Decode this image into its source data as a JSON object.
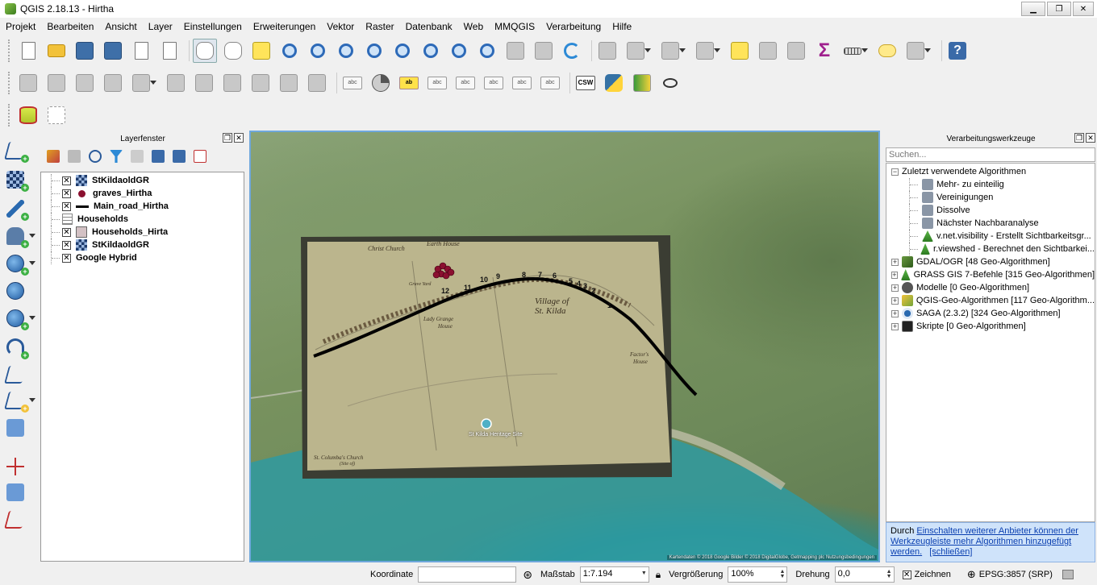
{
  "window": {
    "title": "QGIS 2.18.13 - Hirtha"
  },
  "menu": [
    "Projekt",
    "Bearbeiten",
    "Ansicht",
    "Layer",
    "Einstellungen",
    "Erweiterungen",
    "Vektor",
    "Raster",
    "Datenbank",
    "Web",
    "MMQGIS",
    "Verarbeitung",
    "Hilfe"
  ],
  "layers_panel": {
    "title": "Layerfenster",
    "layers": [
      {
        "name": "StKildaoldGR",
        "checked": true,
        "symbol": "raster",
        "indent": true
      },
      {
        "name": "graves_Hirtha",
        "checked": true,
        "symbol": "point",
        "color": "#8b1030",
        "indent": true
      },
      {
        "name": "Main_road_Hirtha",
        "checked": true,
        "symbol": "line",
        "color": "#000000",
        "indent": true
      },
      {
        "name": "Households",
        "checked": false,
        "symbol": "table",
        "indent": true
      },
      {
        "name": "Households_Hirta",
        "checked": true,
        "symbol": "polygon",
        "color": "#d3c1c4",
        "indent": true
      },
      {
        "name": "StKildaoldGR",
        "checked": true,
        "symbol": "raster",
        "indent": true
      },
      {
        "name": "Google Hybrid",
        "checked": true,
        "symbol": "none",
        "indent": true
      }
    ]
  },
  "map": {
    "labels": {
      "christ_church": "Christ Church",
      "earth_house": "Earth House",
      "village": "Village of",
      "st_kilda": "St. Kilda",
      "lady_grange": "Lady Grange",
      "lady_grange_2": "House",
      "st_columba": "St. Columba's Church",
      "site_of": "(Site of)",
      "factor_house": "Factor's",
      "factor_house_2": "House",
      "grave_yard": "Grave Yard",
      "marker": "St Kilda Heritage Site"
    },
    "house_numbers": [
      "12",
      "11",
      "10",
      "9",
      "8",
      "7",
      "6",
      "5",
      "4",
      "3",
      "2",
      "1"
    ],
    "attribution": "Kartendaten © 2018 Google Bilder © 2018 DigitalGlobe, Getmapping plc  Nutzungsbedingungen"
  },
  "processing_panel": {
    "title": "Verarbeitungswerkzeuge",
    "search_placeholder": "Suchen...",
    "recent_group": "Zuletzt verwendete Algorithmen",
    "recent": [
      "Mehr- zu einteilig",
      "Vereinigungen",
      "Dissolve",
      "Nächster Nachbaranalyse",
      "v.net.visibility - Erstellt Sichtbarkeitsgr...",
      "r.viewshed - Berechnet den Sichtbarkei..."
    ],
    "providers": [
      {
        "label": "GDAL/OGR [48 Geo-Algorithmen]",
        "icon": "gdal"
      },
      {
        "label": "GRASS GIS 7-Befehle [315 Geo-Algorithmen]",
        "icon": "grass"
      },
      {
        "label": "Modelle [0 Geo-Algorithmen]",
        "icon": "model"
      },
      {
        "label": "QGIS-Geo-Algorithmen [117 Geo-Algorithm...",
        "icon": "qgis"
      },
      {
        "label": "SAGA (2.3.2) [324 Geo-Algorithmen]",
        "icon": "saga"
      },
      {
        "label": "Skripte [0 Geo-Algorithmen]",
        "icon": "script"
      }
    ],
    "info_prefix": "Durch",
    "info_link": "Einschalten weiterer Anbieter können der Werkzeugleiste mehr Algorithmen hinzugefügt werden.",
    "info_close": "[schließen]"
  },
  "statusbar": {
    "coord_label": "Koordinate",
    "coord_value": "",
    "scale_label": "Maßstab",
    "scale_value": "1:7.194",
    "magnifier_label": "Vergrößerung",
    "magnifier_value": "100%",
    "rotation_label": "Drehung",
    "rotation_value": "0,0",
    "render_label": "Zeichnen",
    "render_checked": true,
    "crs_label": "EPSG:3857 (SRP)"
  }
}
